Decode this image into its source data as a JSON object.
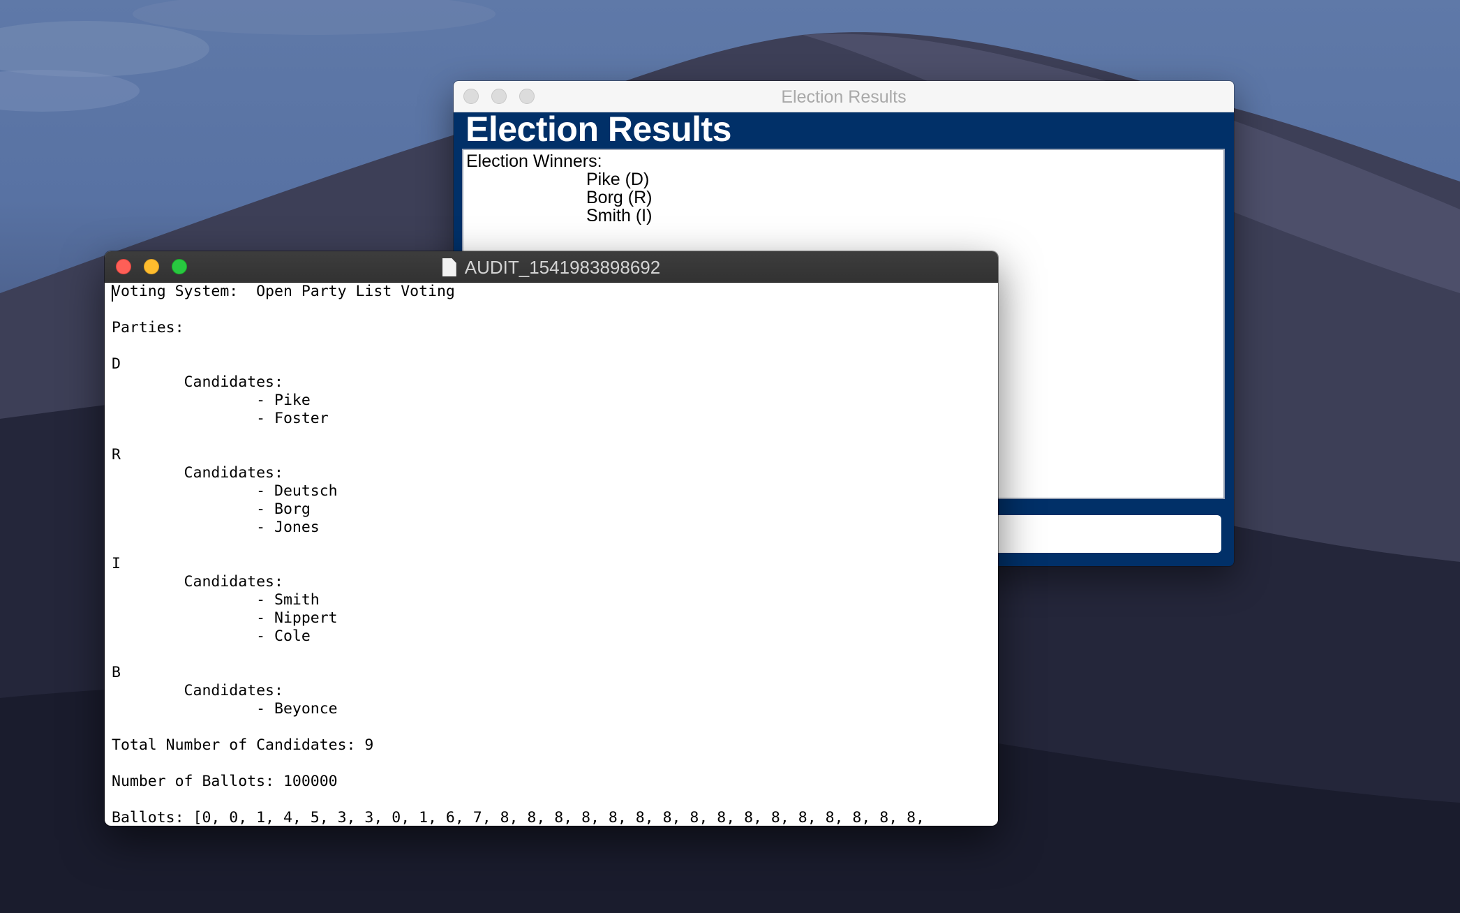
{
  "results_window": {
    "title": "Election Results",
    "heading": "Election Results",
    "winners_label": "Election Winners:",
    "winners": [
      "Pike (D)",
      "Borg (R)",
      "Smith (I)"
    ]
  },
  "audit_window": {
    "title": "AUDIT_1541983898692",
    "lines": [
      "Voting System:  Open Party List Voting",
      "",
      "Parties:",
      "",
      "D",
      "        Candidates:",
      "                - Pike",
      "                - Foster",
      "",
      "R",
      "        Candidates:",
      "                - Deutsch",
      "                - Borg",
      "                - Jones",
      "",
      "I",
      "        Candidates:",
      "                - Smith",
      "                - Nippert",
      "                - Cole",
      "",
      "B",
      "        Candidates:",
      "                - Beyonce",
      "",
      "Total Number of Candidates: 9",
      "",
      "Number of Ballots: 100000",
      "",
      "Ballots: [0, 0, 1, 4, 5, 3, 3, 0, 1, 6, 7, 8, 8, 8, 8, 8, 8, 8, 8, 8, 8, 8, 8, 8, 8, 8, 8,"
    ]
  }
}
